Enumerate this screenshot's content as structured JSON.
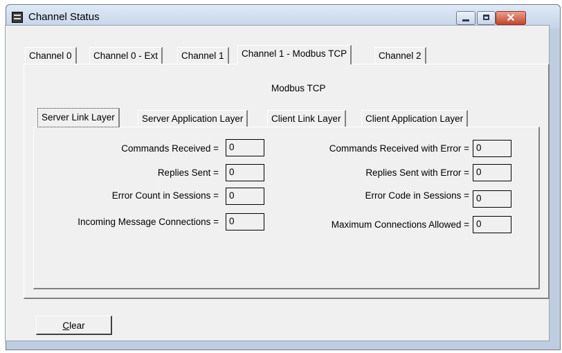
{
  "window": {
    "title": "Channel Status"
  },
  "tabs": [
    "Channel 0",
    "Channel 0 - Ext",
    "Channel 1",
    "Channel 1 - Modbus TCP",
    "Channel 2"
  ],
  "active_tab": "Channel 1 - Modbus TCP",
  "section_title": "Modbus TCP",
  "subtabs": [
    "Server Link Layer",
    "Server Application Layer",
    "Client Link Layer",
    "Client Application Layer"
  ],
  "active_subtab": "Server Link Layer",
  "fields": [
    {
      "label": "Commands Received =",
      "value": "0"
    },
    {
      "label": "Replies Sent =",
      "value": "0"
    },
    {
      "label": "Error Count in Sessions =",
      "value": "0"
    },
    {
      "label": "Incoming Message Connections =",
      "value": "0"
    },
    {
      "label": "Commands Received with Error =",
      "value": "0"
    },
    {
      "label": "Replies Sent with Error =",
      "value": "0"
    },
    {
      "label": "Error Code in Sessions =",
      "value": "0"
    },
    {
      "label": "Maximum Connections Allowed =",
      "value": "0"
    }
  ],
  "clear_button": {
    "mnemonic": "C",
    "rest": "lear"
  }
}
